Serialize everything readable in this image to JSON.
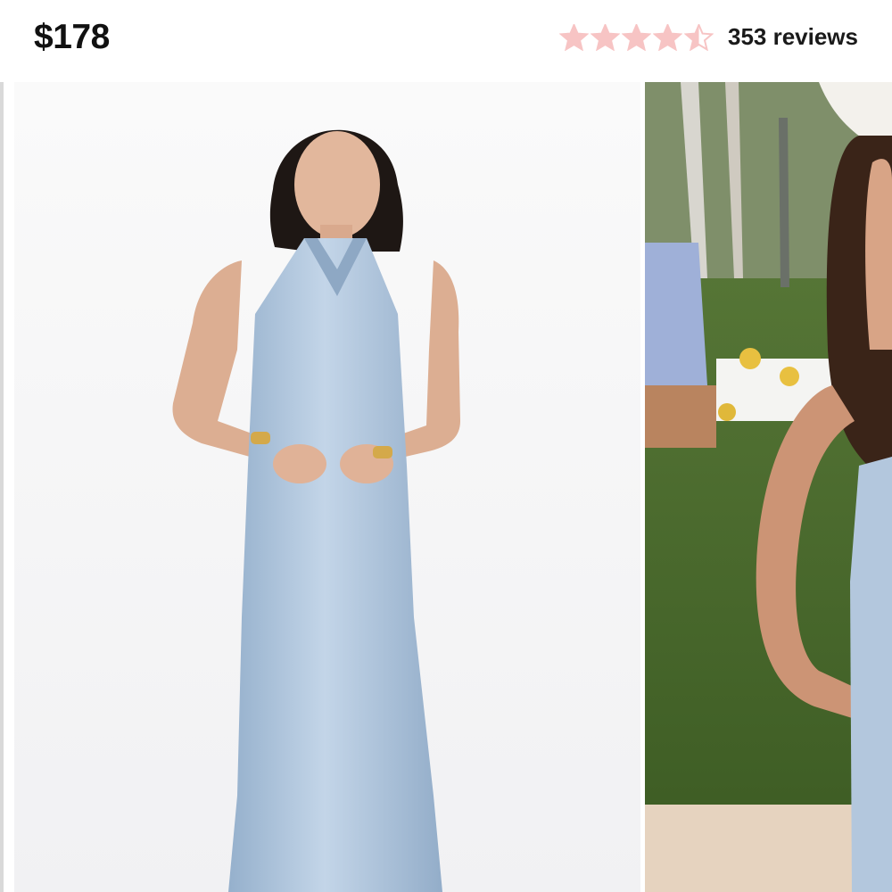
{
  "product": {
    "price": "$178",
    "rating_value": 4.5,
    "rating_max": 5,
    "reviews_text": "353 reviews"
  },
  "colors": {
    "star": "#f7c4c4",
    "price_text": "#111111",
    "dress": "#a9c2dc"
  },
  "gallery": {
    "images": [
      {
        "name": "studio-photo",
        "description_icon": "model-in-light-blue-halter-dress"
      },
      {
        "name": "garden-photo",
        "description_icon": "model-in-garden"
      }
    ]
  }
}
